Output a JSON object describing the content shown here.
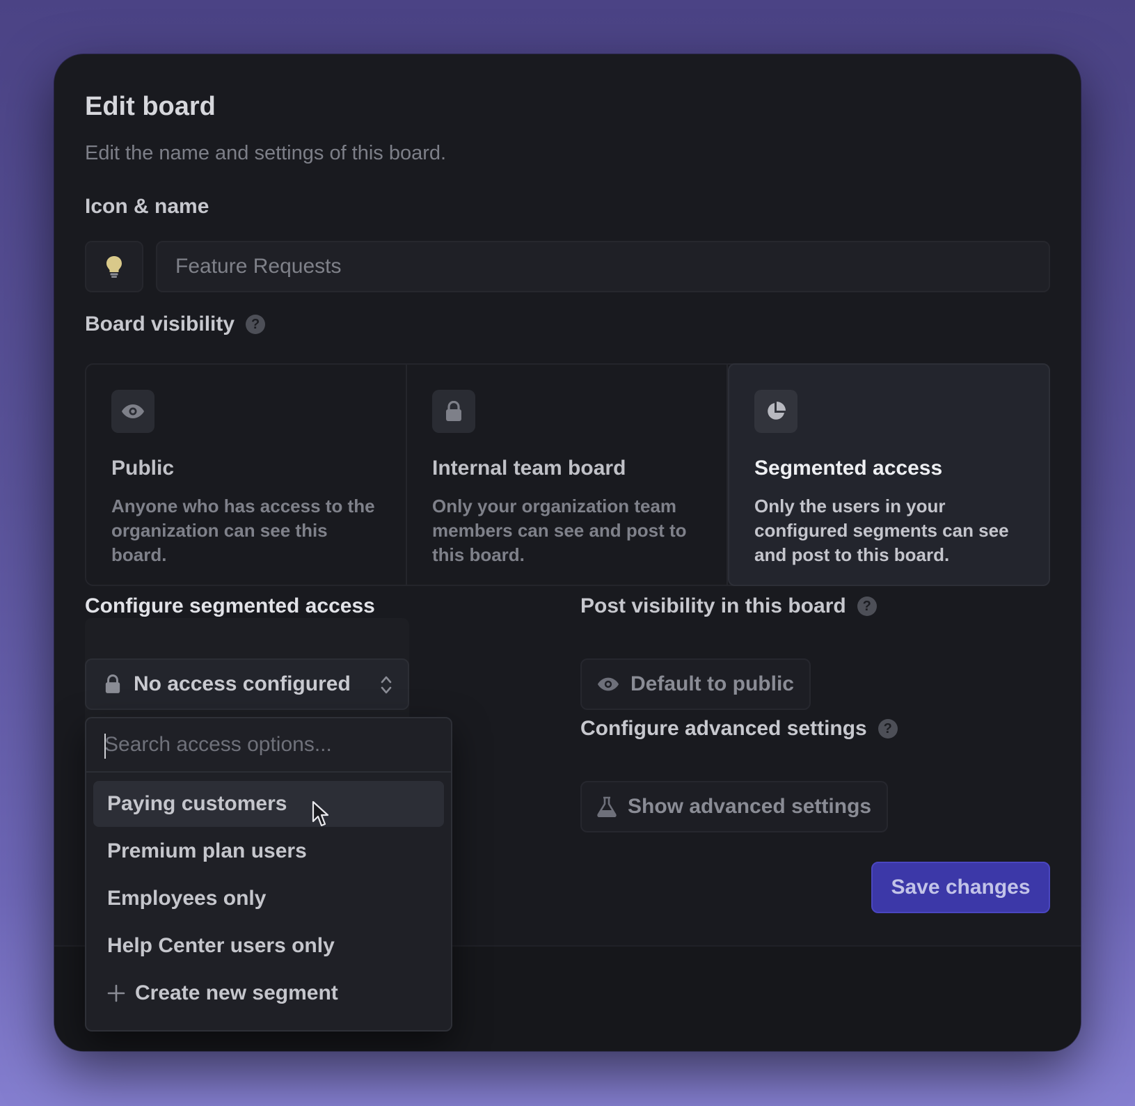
{
  "header": {
    "title": "Edit board",
    "subtitle": "Edit the name and settings of this board."
  },
  "icon_name": {
    "label": "Icon & name",
    "icon": "lightbulb-icon",
    "name_value": "Feature Requests"
  },
  "visibility": {
    "label": "Board visibility",
    "options": [
      {
        "title": "Public",
        "description": "Anyone who has access to the organization can see this board.",
        "icon": "eye-icon",
        "selected": false
      },
      {
        "title": "Internal team board",
        "description": "Only your organization team members can see and post to this board.",
        "icon": "lock-icon",
        "selected": false
      },
      {
        "title": "Segmented access",
        "description": "Only the users in your configured segments can see and post to this board.",
        "icon": "pie-chart-icon",
        "selected": true
      }
    ]
  },
  "segmented": {
    "label": "Configure segmented access",
    "select_value": "No access configured",
    "search_placeholder": "Search access options...",
    "items": [
      "Paying customers",
      "Premium plan users",
      "Employees only",
      "Help Center users only"
    ],
    "create_label": "Create new segment"
  },
  "post_visibility": {
    "label": "Post visibility in this board",
    "value": "Default to public"
  },
  "advanced": {
    "label": "Configure advanced settings",
    "button_label": "Show advanced settings"
  },
  "actions": {
    "save_label": "Save changes"
  },
  "colors": {
    "accent": "#3c38a8",
    "modal_bg": "#191a1f"
  }
}
